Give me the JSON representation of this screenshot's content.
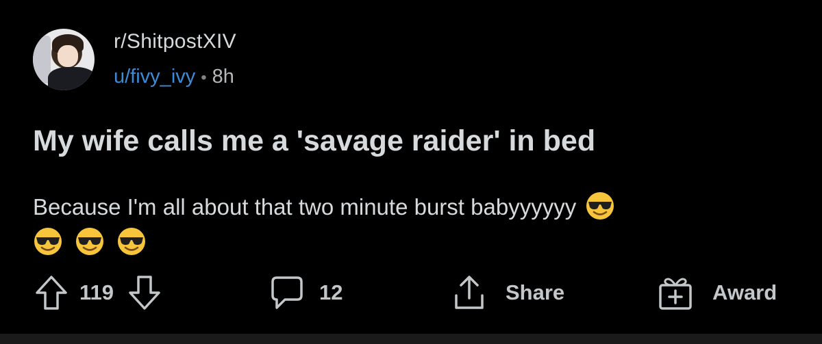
{
  "header": {
    "subreddit": "r/ShitpostXIV",
    "username": "u/fivy_ivy",
    "separator": "•",
    "age": "8h"
  },
  "post": {
    "title": "My wife calls me a 'savage raider' in bed",
    "body": "Because I'm all about that two minute burst babyyyyyy",
    "emojis": [
      "smiling-face-with-sunglasses",
      "smiling-face-with-sunglasses",
      "smiling-face-with-sunglasses",
      "smiling-face-with-sunglasses"
    ]
  },
  "actions": {
    "upvote_count": "119",
    "comment_count": "12",
    "share_label": "Share",
    "award_label": "Award"
  },
  "colors": {
    "background": "#000000",
    "text": "#d7dadc",
    "username": "#3d8bd6",
    "muted": "#818384"
  }
}
